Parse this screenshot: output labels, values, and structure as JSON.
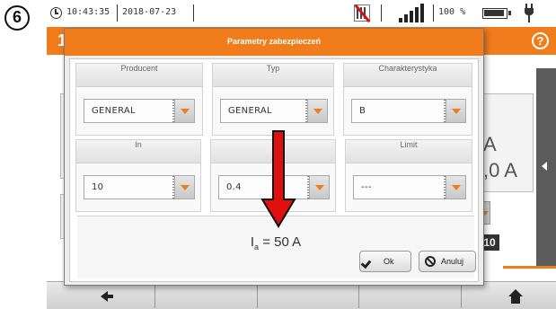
{
  "step_badge": "6",
  "status": {
    "time": "10:43:35",
    "date": "2018-07-23",
    "battery": "100 %"
  },
  "title_number": "1",
  "dialog": {
    "title": "Parametry zabezpieczeń",
    "fields": [
      {
        "label": "Producent",
        "value": "GENERAL"
      },
      {
        "label": "Typ",
        "value": "GENERAL"
      },
      {
        "label": "Charakterystyka",
        "value": "B"
      },
      {
        "label": "In",
        "value": "10"
      },
      {
        "label": "t",
        "value": "0.4"
      },
      {
        "label": "Limit",
        "value": "---"
      }
    ],
    "result": {
      "symbol": "I",
      "subscript": "a",
      "text": " = 50 A"
    },
    "ok_label": "Ok",
    "cancel_label": "Anuluj"
  },
  "background": {
    "unit_a": "A",
    "value_a": ",0 A",
    "badge": "10"
  },
  "colors": {
    "accent": "#f07c1c",
    "arrow": "#e01010"
  }
}
